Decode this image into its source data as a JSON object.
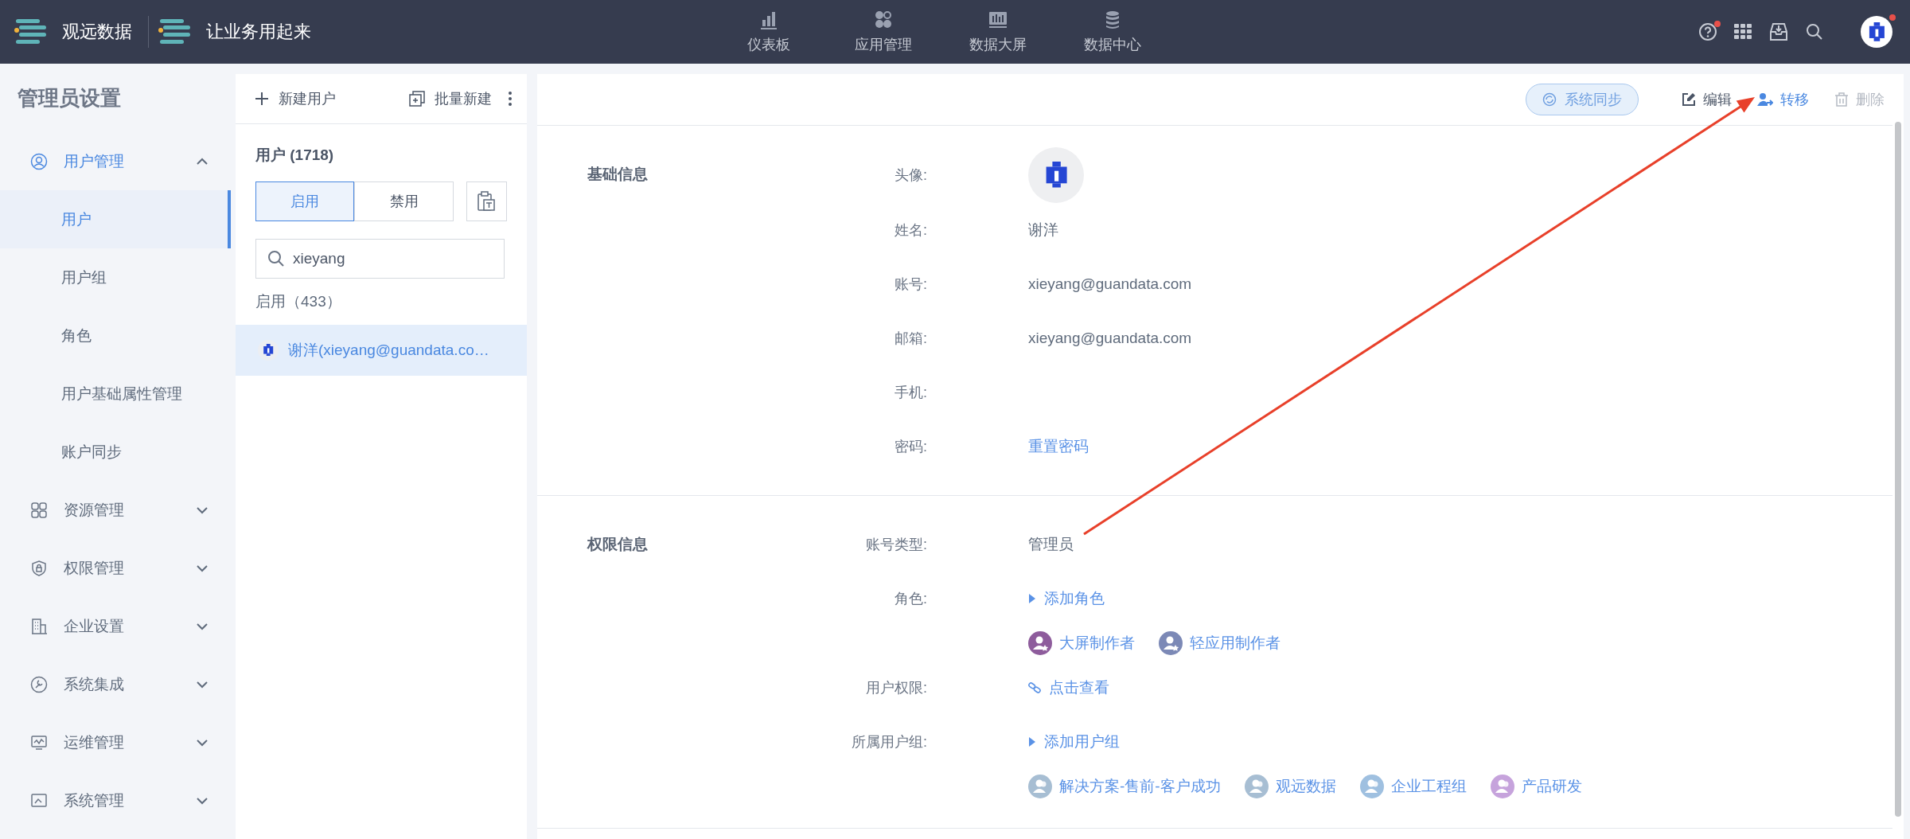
{
  "topbar": {
    "brand": "观远数据",
    "slogan": "让业务用起来",
    "nav": [
      {
        "label": "仪表板",
        "kind": "dashboard"
      },
      {
        "label": "应用管理",
        "kind": "apps"
      },
      {
        "label": "数据大屏",
        "kind": "screen"
      },
      {
        "label": "数据中心",
        "kind": "datacenter"
      }
    ],
    "tools": [
      {
        "kind": "help",
        "dot": true
      },
      {
        "kind": "grid",
        "dot": false
      },
      {
        "kind": "inbox",
        "dot": false
      },
      {
        "kind": "search",
        "dot": false
      },
      {
        "kind": "avatar",
        "dot": true
      }
    ]
  },
  "sidebar": {
    "title": "管理员设置",
    "items": [
      {
        "label": "用户管理",
        "kind": "user",
        "expanded": true,
        "children": [
          {
            "label": "用户",
            "selected": true
          },
          {
            "label": "用户组",
            "selected": false
          },
          {
            "label": "角色",
            "selected": false
          },
          {
            "label": "用户基础属性管理",
            "selected": false
          },
          {
            "label": "账户同步",
            "selected": false
          }
        ]
      },
      {
        "label": "资源管理",
        "kind": "resource",
        "expanded": false
      },
      {
        "label": "权限管理",
        "kind": "shield",
        "expanded": false
      },
      {
        "label": "企业设置",
        "kind": "building",
        "expanded": false
      },
      {
        "label": "系统集成",
        "kind": "integration",
        "expanded": false
      },
      {
        "label": "运维管理",
        "kind": "monitor",
        "expanded": false
      },
      {
        "label": "系统管理",
        "kind": "system",
        "expanded": false
      }
    ]
  },
  "user_list": {
    "actions": [
      {
        "label": "新建用户",
        "kind": "plus"
      },
      {
        "label": "批量新建",
        "kind": "batch"
      }
    ],
    "title": "用户 (1718)",
    "tabs": [
      {
        "label": "启用",
        "selected": true
      },
      {
        "label": "禁用",
        "selected": false
      }
    ],
    "search": {
      "value": "xieyang"
    },
    "group_label": "启用（433）",
    "rows": [
      {
        "name": "谢洋(xieyang@guandata.co…",
        "selected": true
      }
    ]
  },
  "detail": {
    "actions": [
      {
        "label": "系统同步",
        "kind": "sync",
        "disabled": false,
        "highlighted": false
      },
      {
        "label": "编辑",
        "kind": "edit",
        "disabled": false,
        "highlighted": false
      },
      {
        "label": "转移",
        "kind": "transfer",
        "disabled": false,
        "highlighted": true
      },
      {
        "label": "删除",
        "kind": "delete",
        "disabled": true,
        "highlighted": false
      }
    ],
    "sections": [
      {
        "title": "基础信息",
        "fields": [
          {
            "label": "头像:",
            "kind": "avatar"
          },
          {
            "label": "姓名:",
            "kind": "text",
            "value": "谢洋"
          },
          {
            "label": "账号:",
            "kind": "text",
            "value": "xieyang@guandata.com"
          },
          {
            "label": "邮箱:",
            "kind": "text",
            "value": "xieyang@guandata.com"
          },
          {
            "label": "手机:",
            "kind": "text"
          },
          {
            "label": "密码:",
            "kind": "link",
            "value": "重置密码"
          }
        ]
      },
      {
        "title": "权限信息",
        "fields": [
          {
            "label": "账号类型:",
            "kind": "text",
            "value": "管理员"
          },
          {
            "label": "角色:",
            "kind": "add",
            "value": "添加角色",
            "chips": [
              {
                "label": "大屏制作者",
                "kind": "role",
                "color": "#8e5c9c"
              },
              {
                "label": "轻应用制作者",
                "kind": "role",
                "color": "#7c89b6"
              }
            ]
          },
          {
            "label": "用户权限:",
            "kind": "chain",
            "value": "点击查看"
          },
          {
            "label": "所属用户组:",
            "kind": "add",
            "value": "添加用户组",
            "chips": [
              {
                "label": "解决方案-售前-客户成功",
                "kind": "group",
                "color": "#a7bed3"
              },
              {
                "label": "观远数据",
                "kind": "group",
                "color": "#a7bed3"
              },
              {
                "label": "企业工程组",
                "kind": "group",
                "color": "#9fc0e0"
              },
              {
                "label": "产品研发",
                "kind": "group",
                "color": "#c6a3dc"
              }
            ]
          }
        ]
      }
    ]
  },
  "annotations": [
    {
      "kind": "arrow"
    }
  ]
}
